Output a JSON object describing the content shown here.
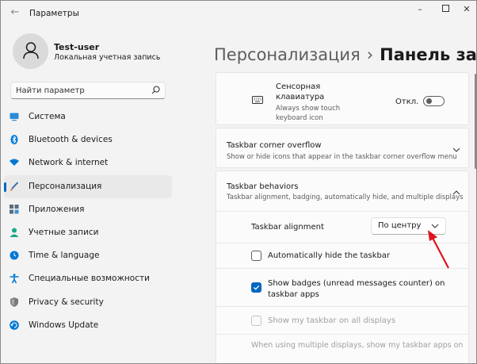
{
  "window": {
    "title": "Параметры",
    "back_icon": "back-arrow-icon",
    "controls": [
      "minimize-icon",
      "maximize-icon",
      "close-icon"
    ]
  },
  "user": {
    "name": "Test-user",
    "account_type": "Локальная учетная запись"
  },
  "search": {
    "placeholder": "Найти параметр"
  },
  "sidebar": {
    "items": [
      {
        "label": "Система",
        "icon": "monitor-icon",
        "color": "#0078d4"
      },
      {
        "label": "Bluetooth & devices",
        "icon": "bluetooth-icon",
        "color": "#0078d4"
      },
      {
        "label": "Network & internet",
        "icon": "wifi-icon",
        "color": "#0078d4"
      },
      {
        "label": "Персонализация",
        "icon": "brush-icon",
        "color": "#c45a1a",
        "active": true
      },
      {
        "label": "Приложения",
        "icon": "apps-icon",
        "color": "#4a5a6a"
      },
      {
        "label": "Учетные записи",
        "icon": "person-icon",
        "color": "#10a37f"
      },
      {
        "label": "Time & language",
        "icon": "globe-clock-icon",
        "color": "#0078d4"
      },
      {
        "label": "Специальные возможности",
        "icon": "accessibility-icon",
        "color": "#0078d4"
      },
      {
        "label": "Privacy & security",
        "icon": "shield-icon",
        "color": "#6b6b6b"
      },
      {
        "label": "Windows Update",
        "icon": "update-icon",
        "color": "#0078d4"
      }
    ]
  },
  "header": {
    "parent": "Персонализация",
    "separator": "›",
    "current": "Панель задач"
  },
  "touch_keyboard": {
    "title_line1": "Сенсорная",
    "title_line2": "клавиатура",
    "desc_line1": "Always show touch",
    "desc_line2": "keyboard icon",
    "state": "Откл."
  },
  "corner_overflow": {
    "title": "Taskbar corner overflow",
    "desc": "Show or hide icons that appear in the taskbar corner overflow menu"
  },
  "behaviors": {
    "title": "Taskbar behaviors",
    "desc": "Taskbar alignment, badging, automatically hide, and multiple displays",
    "alignment_label": "Taskbar alignment",
    "alignment_value": "По центру",
    "auto_hide": "Automatically hide the taskbar",
    "badges_line1": "Show badges (unread messages counter) on",
    "badges_line2": "taskbar apps",
    "show_all_displays": "Show my taskbar on all displays",
    "multi_display": "When using multiple displays, show my taskbar apps on"
  },
  "colors": {
    "accent": "#0067c0",
    "annotation_arrow": "#e0141e"
  }
}
